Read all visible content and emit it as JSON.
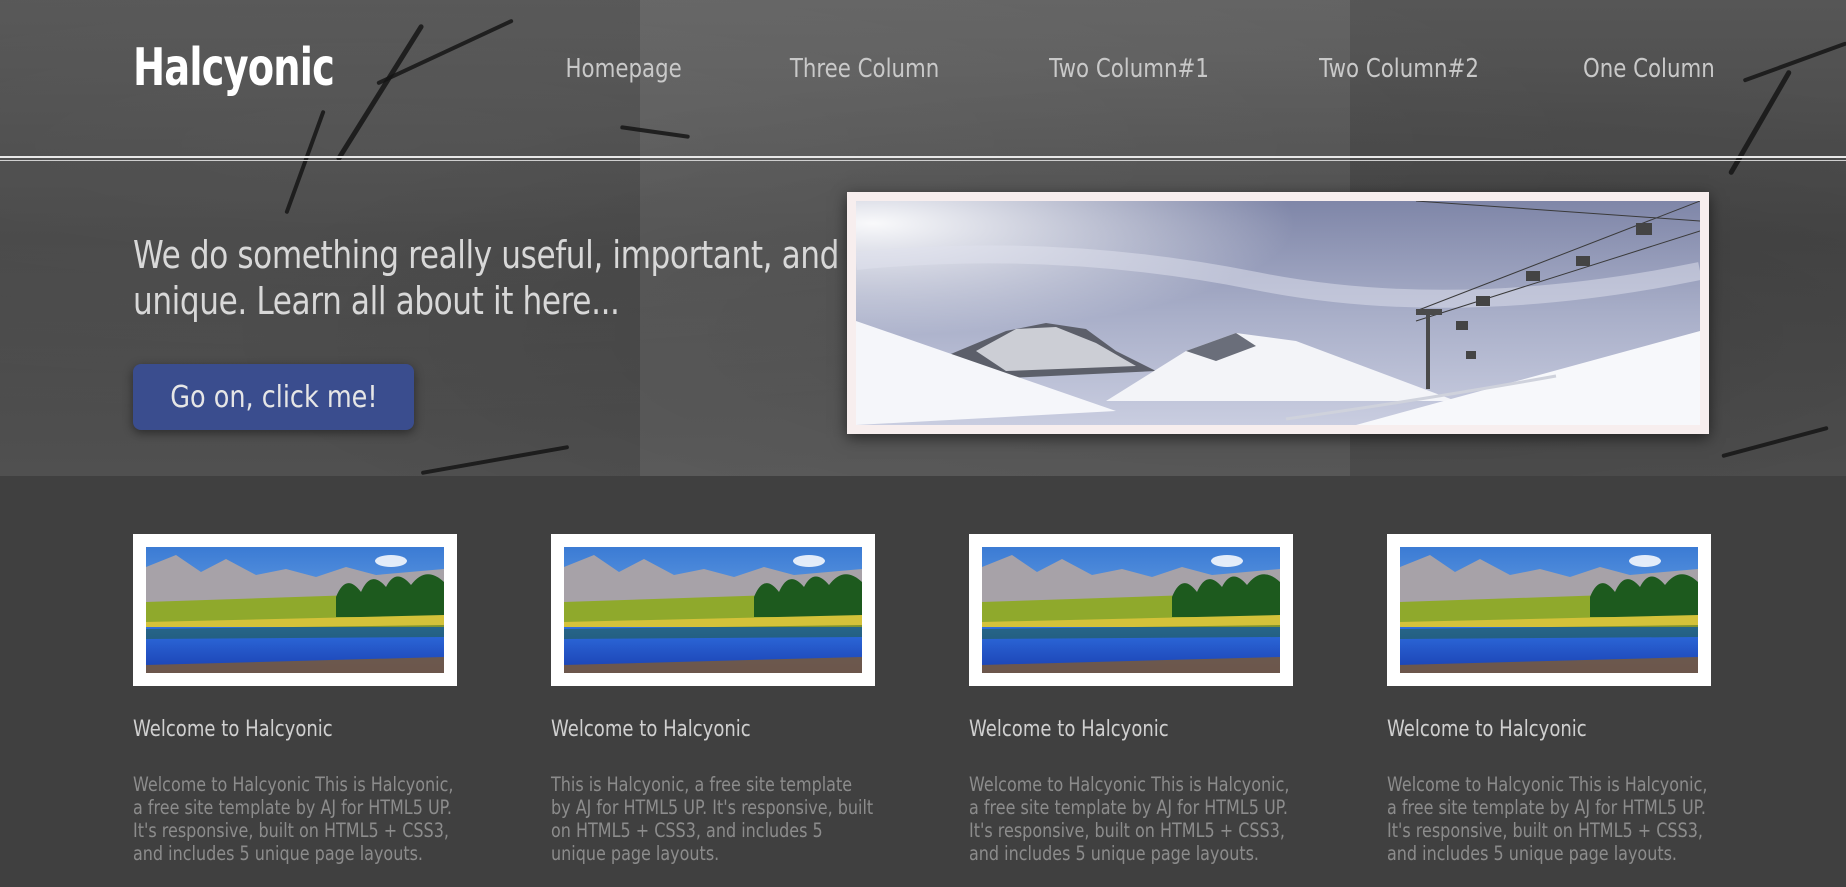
{
  "site": {
    "logo": "Halcyonic"
  },
  "nav": {
    "items": [
      {
        "label": "Homepage"
      },
      {
        "label": "Three Column"
      },
      {
        "label": "Two Column#1"
      },
      {
        "label": "Two Column#2"
      },
      {
        "label": "One Column"
      }
    ]
  },
  "banner": {
    "headline": "We do something really useful, important, and unique. Learn all about it here...",
    "button_label": "Go on, click me!",
    "image_icon": "mountain-ski-lift-photo"
  },
  "features": [
    {
      "title": "Welcome to Halcyonic",
      "text": "Welcome to Halcyonic This is Halcyonic, a free site template by AJ for HTML5 UP. It's responsive, built on HTML5 + CSS3, and includes 5 unique page layouts.",
      "image_icon": "mountain-lake-photo"
    },
    {
      "title": "Welcome to Halcyonic",
      "text": "This is Halcyonic, a free site template by AJ for HTML5 UP. It's responsive, built on HTML5 + CSS3, and includes 5 unique page layouts.",
      "image_icon": "mountain-lake-photo"
    },
    {
      "title": "Welcome to Halcyonic",
      "text": "Welcome to Halcyonic This is Halcyonic, a free site template by AJ for HTML5 UP. It's responsive, built on HTML5 + CSS3, and includes 5 unique page layouts.",
      "image_icon": "mountain-lake-photo"
    },
    {
      "title": "Welcome to Halcyonic",
      "text": "Welcome to Halcyonic This is Halcyonic, a free site template by AJ for HTML5 UP. It's responsive, built on HTML5 + CSS3, and includes 5 unique page layouts.",
      "image_icon": "mountain-lake-photo"
    }
  ],
  "colors": {
    "button": "#3a4d8e",
    "content_background": "#404040",
    "heading_text": "#d0d0d0",
    "body_text": "#8c8c8c"
  }
}
